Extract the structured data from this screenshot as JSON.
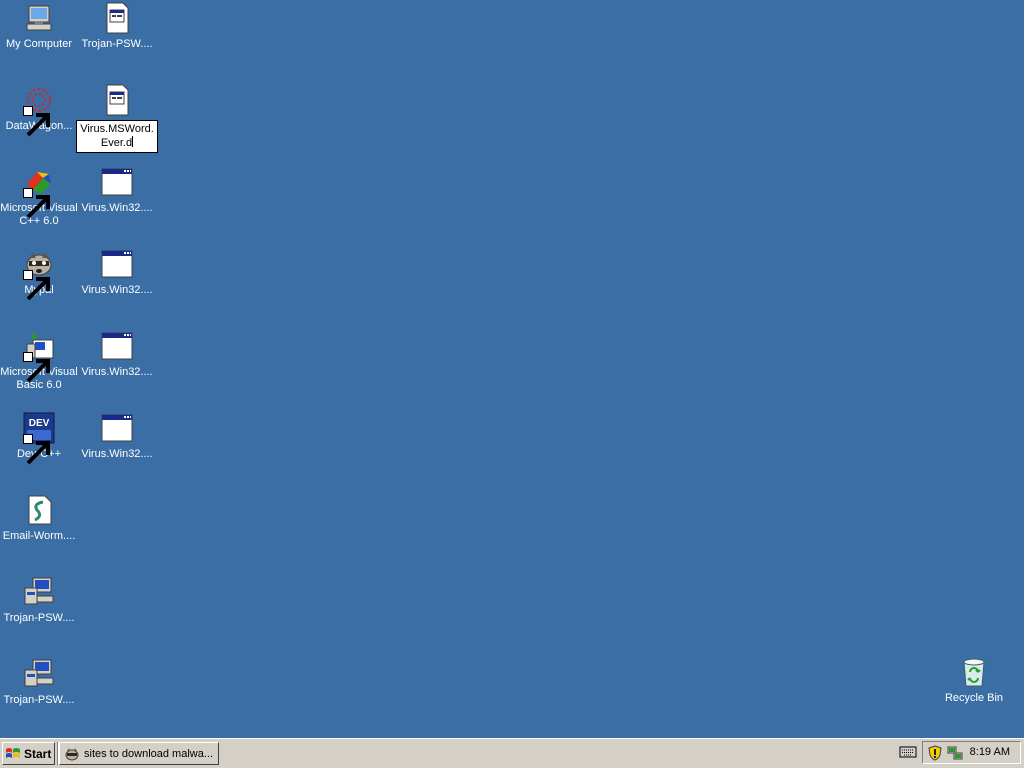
{
  "desktop": {
    "icons": {
      "my_computer": "My Computer",
      "trojan_psw_1": "Trojan-PSW....",
      "datawagon": "DataWagon...",
      "virus_msword_rename": [
        "Virus.MSWord.",
        "Ever.d"
      ],
      "ms_visual_cpp": "Microsoft Visual C++ 6.0",
      "virus_win32_1": "Virus.Win32....",
      "mypal": "Mypal",
      "virus_win32_2": "Virus.Win32....",
      "ms_visual_basic": "Microsoft Visual Basic 6.0",
      "virus_win32_3": "Virus.Win32....",
      "dev_cpp": "Dev-C++",
      "virus_win32_4": "Virus.Win32....",
      "email_worm": "Email-Worm....",
      "trojan_psw_2": "Trojan-PSW....",
      "trojan_psw_3": "Trojan-PSW....",
      "recycle_bin": "Recycle Bin"
    },
    "dev_cpp_badge": "DEV"
  },
  "taskbar": {
    "start_label": "Start",
    "task_label": "sites to download malwa...",
    "clock": "8:19 AM"
  },
  "colors": {
    "desktop_bg": "#3a6ea5",
    "taskbar_bg": "#d4d0c8"
  }
}
